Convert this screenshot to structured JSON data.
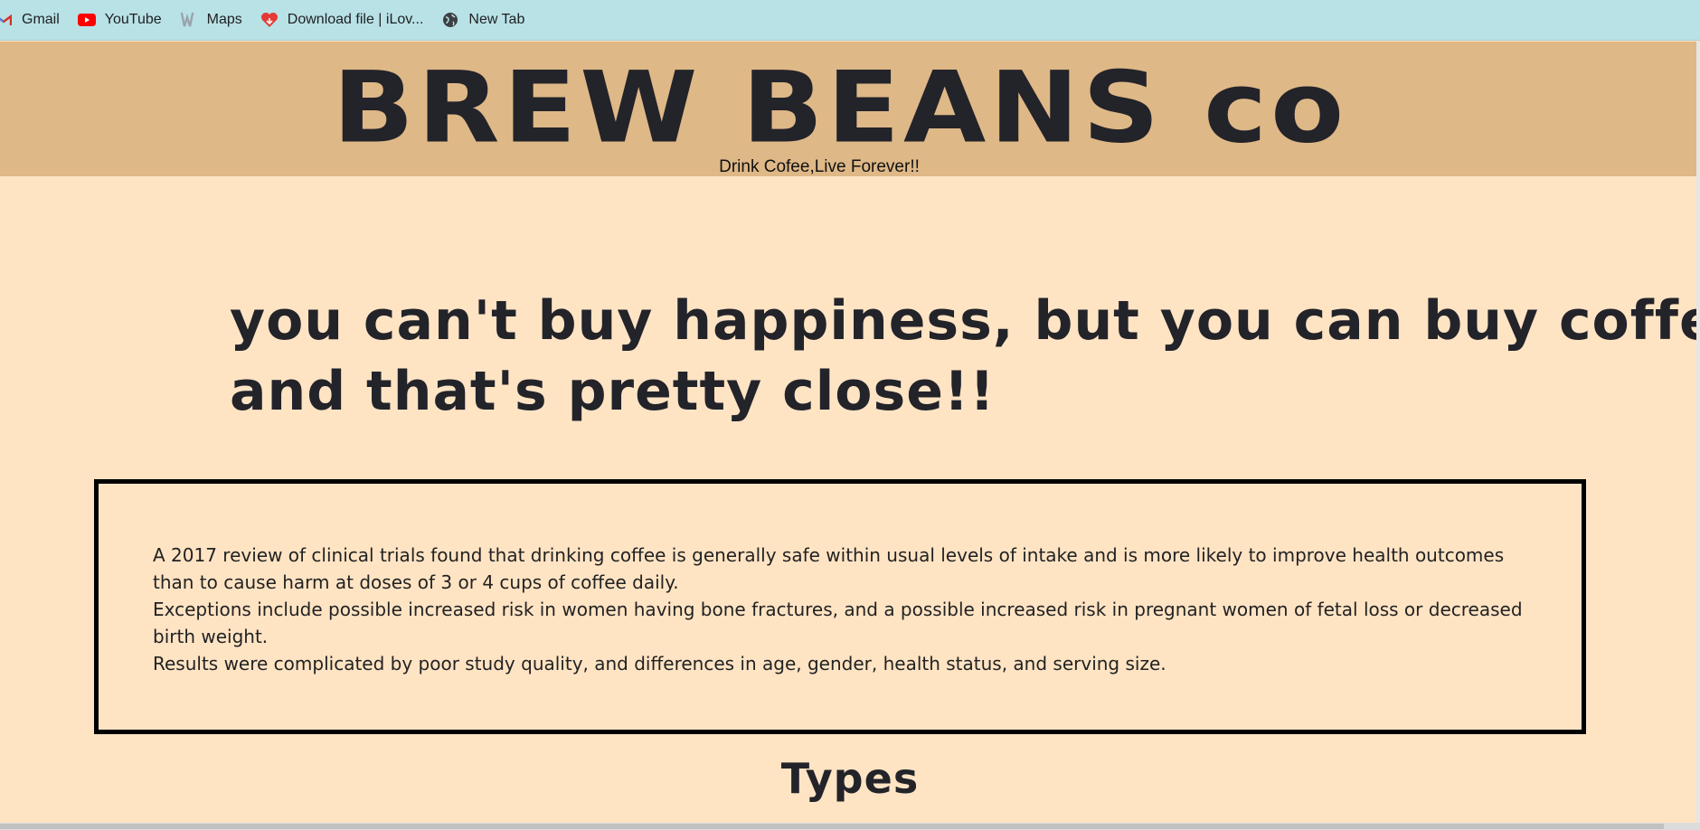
{
  "bookmarks": [
    {
      "label": "Gmail",
      "icon": "gmail-icon"
    },
    {
      "label": "YouTube",
      "icon": "youtube-icon"
    },
    {
      "label": "Maps",
      "icon": "maps-icon"
    },
    {
      "label": "Download file | iLov...",
      "icon": "heart-icon"
    },
    {
      "label": "New Tab",
      "icon": "globe-icon"
    }
  ],
  "header": {
    "title": "BREW BEANS co",
    "tagline": "Drink Cofee,Live Forever!!"
  },
  "quote": {
    "line1": "you can't buy happiness, but you can buy coffee,",
    "line2": "and that's pretty close!!"
  },
  "info": {
    "paragraph1": "A 2017 review of clinical trials found that drinking coffee is generally safe within usual levels of intake and is more likely to improve health outcomes than to cause harm at doses of 3 or 4 cups of coffee daily.",
    "paragraph2": "Exceptions include possible increased risk in women having bone fractures, and a possible increased risk in pregnant women of fetal loss or decreased birth weight.",
    "paragraph3": "Results were complicated by poor study quality, and differences in age, gender, health status, and serving size."
  },
  "sections": {
    "types_heading": "Types"
  },
  "colors": {
    "bookmarks_bar": "#b8e2e6",
    "header_bg": "#deb887",
    "page_bg": "#ffe4c4",
    "text_dark": "#23232a"
  }
}
